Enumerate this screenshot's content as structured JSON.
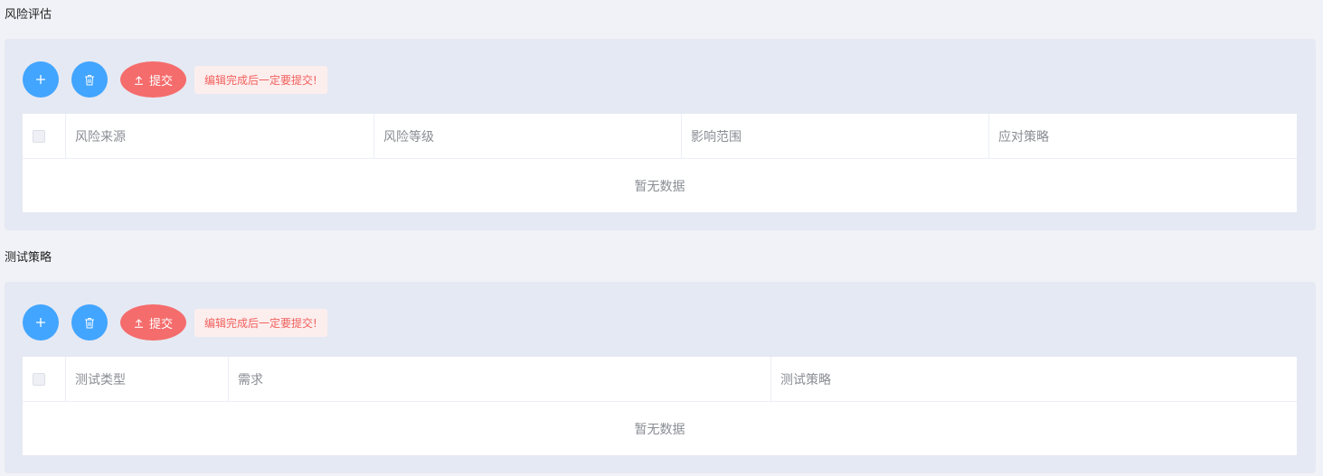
{
  "sections": [
    {
      "title": "风险评估",
      "submit_label": "提交",
      "tip": "编辑完成后一定要提交!",
      "columns": [
        "风险来源",
        "风险等级",
        "影响范围",
        "应对策略"
      ],
      "empty_text": "暂无数据"
    },
    {
      "title": "测试策略",
      "submit_label": "提交",
      "tip": "编辑完成后一定要提交!",
      "columns": [
        "测试类型",
        "需求",
        "测试策略"
      ],
      "empty_text": "暂无数据"
    }
  ],
  "icons": {
    "add": "plus-icon",
    "delete": "trash-icon",
    "submit": "upload-icon"
  },
  "colors": {
    "primary": "#42a5ff",
    "danger": "#f56c6c",
    "tip_bg": "#fdeeee",
    "tip_text": "#f0605c",
    "panel_bg": "#e5e9f3"
  }
}
